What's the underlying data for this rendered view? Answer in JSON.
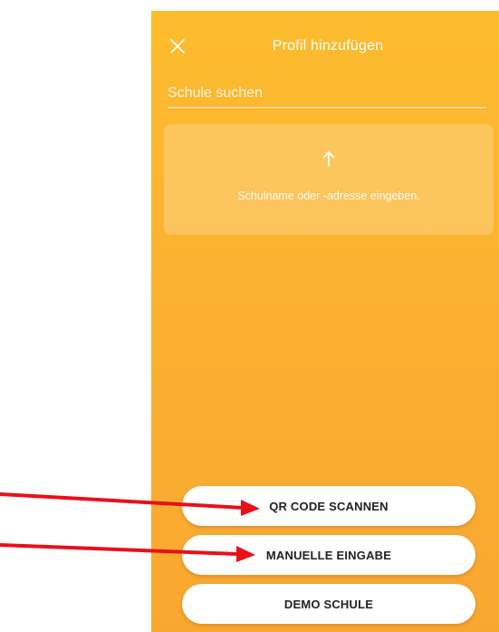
{
  "header": {
    "title": "Profil hinzufügen",
    "close_icon": "close-icon"
  },
  "search": {
    "placeholder": "Schule suchen",
    "value": ""
  },
  "hint": {
    "icon": "arrow-up-icon",
    "text": "Schulname oder -adresse eingeben."
  },
  "actions": {
    "qr_label": "QR CODE SCANNEN",
    "manual_label": "MANUELLE EINGABE",
    "demo_label": "DEMO SCHULE"
  },
  "annotations": {
    "arrow_color": "#e8101a",
    "targets": [
      "QR CODE SCANNEN",
      "MANUELLE EINGABE"
    ]
  },
  "colors": {
    "background_top": "#fdbc2e",
    "background_bottom": "#f9a731",
    "button_bg": "#ffffff",
    "button_text": "#222222"
  }
}
